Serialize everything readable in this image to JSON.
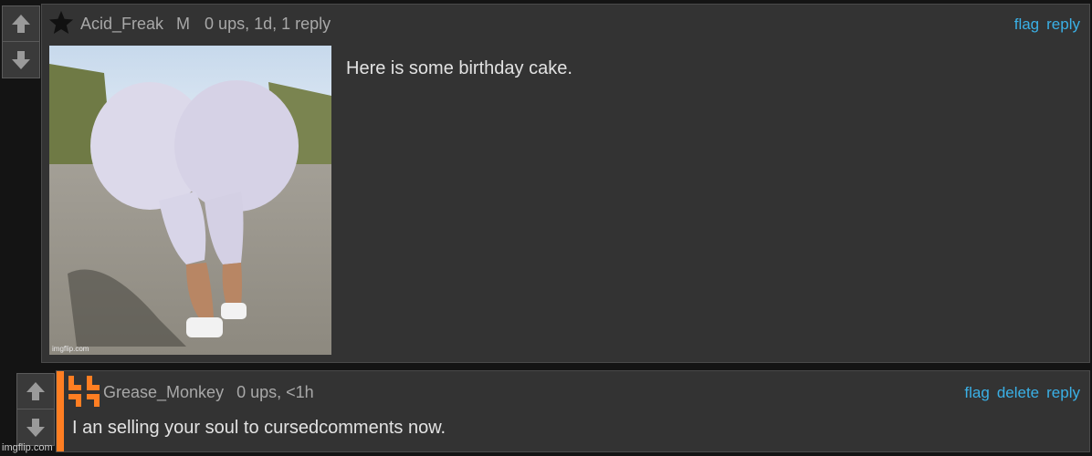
{
  "comments": [
    {
      "username": "Acid_Freak",
      "badge": "M",
      "stats": "0 ups, 1d, 1 reply",
      "body": "Here is some birthday cake.",
      "actions": [
        "flag",
        "reply"
      ],
      "user_icon": "star-icon",
      "image_watermark": "imgflip.com"
    },
    {
      "username": "Grease_Monkey",
      "stats": "0 ups, <1h",
      "body": "I an selling your soul to cursedcomments now.",
      "actions": [
        "flag",
        "delete",
        "reply"
      ],
      "user_icon": "imgflip-logo-icon",
      "accent_color": "#ff7e22"
    }
  ],
  "watermark": "imgflip.com",
  "colors": {
    "background": "#141414",
    "panel": "#333333",
    "link": "#3ab0e6",
    "accent": "#ff7e22"
  }
}
